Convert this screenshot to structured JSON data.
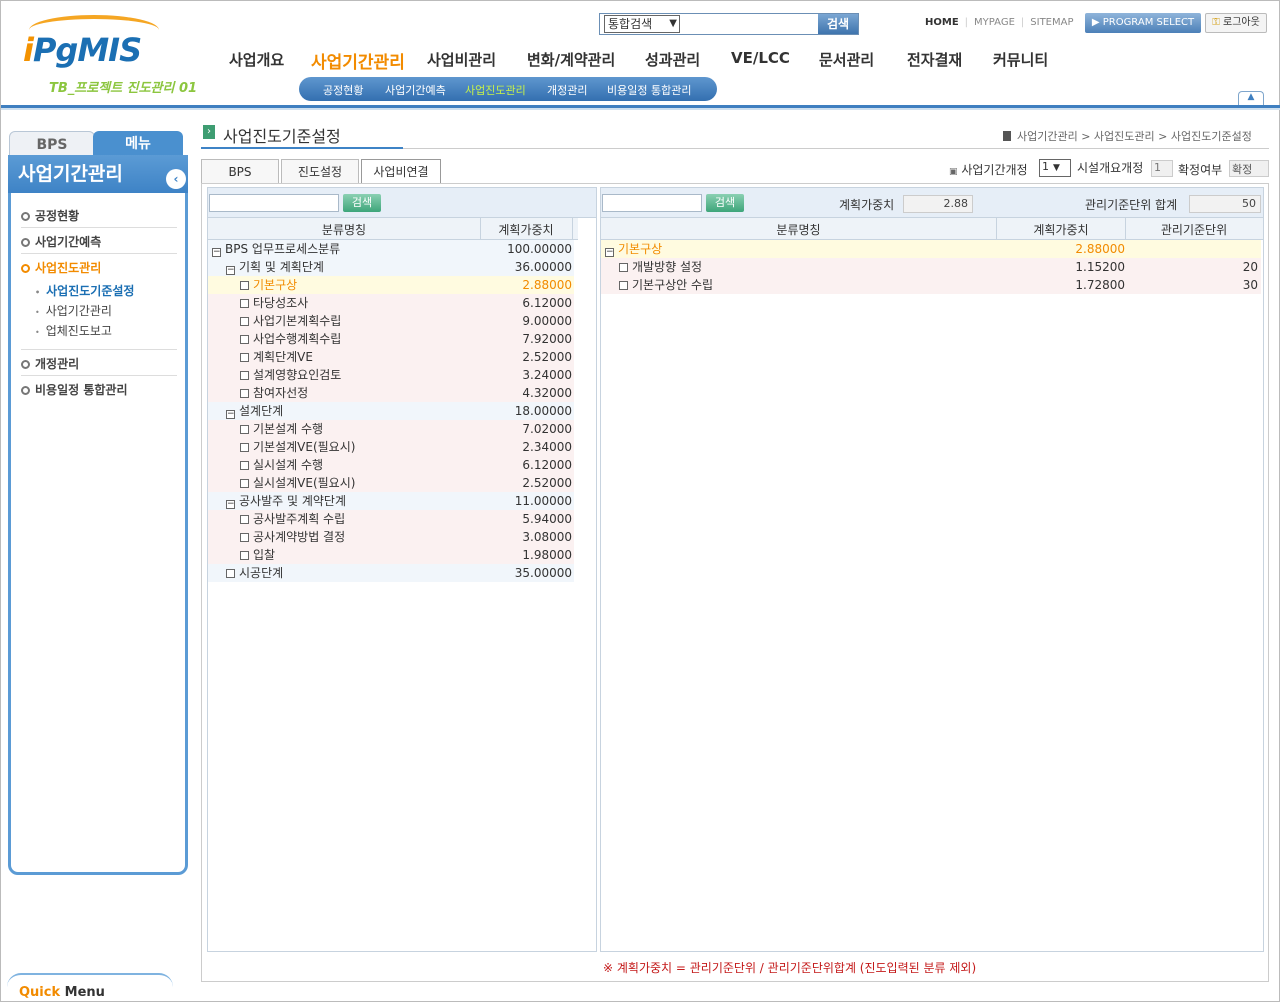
{
  "logo": {
    "text_i": "i",
    "text": "PgMIS",
    "project": "TB_프로젝트 진도관리 01"
  },
  "search": {
    "select": "통합검색",
    "button": "검색"
  },
  "top_links": [
    "HOME",
    "MYPAGE",
    "SITEMAP"
  ],
  "program_select": "▶ PROGRAM SELECT",
  "logout": "로그아웃",
  "gnb": [
    "사업개요",
    "사업기간관리",
    "사업비관리",
    "변화/계약관리",
    "성과관리",
    "VE/LCC",
    "문서관리",
    "전자결재",
    "커뮤니티"
  ],
  "subnav": [
    "공정현황",
    "사업기간예측",
    "사업진도관리",
    "개정관리",
    "비용일정 통합관리"
  ],
  "sidebar": {
    "tab_bps": "BPS",
    "tab_menu": "메뉴",
    "title": "사업기간관리",
    "items": [
      "공정현황",
      "사업기간예측",
      "사업진도관리",
      "개정관리",
      "비용일정 통합관리"
    ],
    "subitems": [
      "사업진도기준설정",
      "사업기간관리",
      "업체진도보고"
    ],
    "quick_q": "Quick",
    "quick_menu": " Menu"
  },
  "page": {
    "title": "사업진도기준설정",
    "breadcrumb": "사업기간관리 > 사업진도관리 > 사업진도기준설정",
    "tabs": [
      "BPS",
      "진도설정",
      "사업비연결"
    ],
    "rev_label": "사업기간개정",
    "rev_value": "1",
    "facility_label": "시설개요개정",
    "facility_value": "1",
    "confirm_label": "확정여부",
    "confirm_value": "확정"
  },
  "left_panel": {
    "search_button": "검색",
    "columns": [
      "분류명칭",
      "계획가중치"
    ],
    "rows": [
      {
        "name": "BPS 업무프로세스분류",
        "value": "100.00000",
        "level": 0,
        "expander": "⊟",
        "hl": false
      },
      {
        "name": "기획 및 계획단계",
        "value": "36.00000",
        "level": 1,
        "expander": "⊟",
        "hl": false
      },
      {
        "name": "기본구상",
        "value": "2.88000",
        "level": 2,
        "expander": "□",
        "hl": true
      },
      {
        "name": "타당성조사",
        "value": "6.12000",
        "level": 2,
        "expander": "□",
        "hl": false
      },
      {
        "name": "사업기본계획수립",
        "value": "9.00000",
        "level": 2,
        "expander": "□",
        "hl": false
      },
      {
        "name": "사업수행계획수립",
        "value": "7.92000",
        "level": 2,
        "expander": "□",
        "hl": false
      },
      {
        "name": "계획단계VE",
        "value": "2.52000",
        "level": 2,
        "expander": "□",
        "hl": false
      },
      {
        "name": "설계영향요인검토",
        "value": "3.24000",
        "level": 2,
        "expander": "□",
        "hl": false
      },
      {
        "name": "참여자선정",
        "value": "4.32000",
        "level": 2,
        "expander": "□",
        "hl": false
      },
      {
        "name": "설계단계",
        "value": "18.00000",
        "level": 1,
        "expander": "⊟",
        "hl": false
      },
      {
        "name": "기본설계 수행",
        "value": "7.02000",
        "level": 2,
        "expander": "□",
        "hl": false
      },
      {
        "name": "기본설계VE(필요시)",
        "value": "2.34000",
        "level": 2,
        "expander": "□",
        "hl": false
      },
      {
        "name": "실시설계 수행",
        "value": "6.12000",
        "level": 2,
        "expander": "□",
        "hl": false
      },
      {
        "name": "실시설계VE(필요시)",
        "value": "2.52000",
        "level": 2,
        "expander": "□",
        "hl": false
      },
      {
        "name": "공사발주 및 계약단계",
        "value": "11.00000",
        "level": 1,
        "expander": "⊟",
        "hl": false
      },
      {
        "name": "공사발주계획 수립",
        "value": "5.94000",
        "level": 2,
        "expander": "□",
        "hl": false
      },
      {
        "name": "공사계약방법 결정",
        "value": "3.08000",
        "level": 2,
        "expander": "□",
        "hl": false
      },
      {
        "name": "입찰",
        "value": "1.98000",
        "level": 2,
        "expander": "□",
        "hl": false
      },
      {
        "name": "시공단계",
        "value": "35.00000",
        "level": 1,
        "expander": "□",
        "hl": false
      }
    ]
  },
  "right_panel": {
    "search_button": "검색",
    "weight_label": "계획가중치",
    "weight_value": "2.88",
    "sum_label": "관리기준단위 합계",
    "sum_value": "50",
    "columns": [
      "분류명칭",
      "계획가중치",
      "관리기준단위"
    ],
    "rows": [
      {
        "name": "기본구상",
        "value": "2.88000",
        "unit": "",
        "level": 0,
        "expander": "⊟",
        "hl": true
      },
      {
        "name": "개발방향 설정",
        "value": "1.15200",
        "unit": "20",
        "level": 1,
        "expander": "□",
        "hl": false
      },
      {
        "name": "기본구상안 수립",
        "value": "1.72800",
        "unit": "30",
        "level": 1,
        "expander": "□",
        "hl": false
      }
    ]
  },
  "formula": "※ 계획가중치 = 관리기준단위 / 관리기준단위합계 (진도입력된 분류 제외)"
}
